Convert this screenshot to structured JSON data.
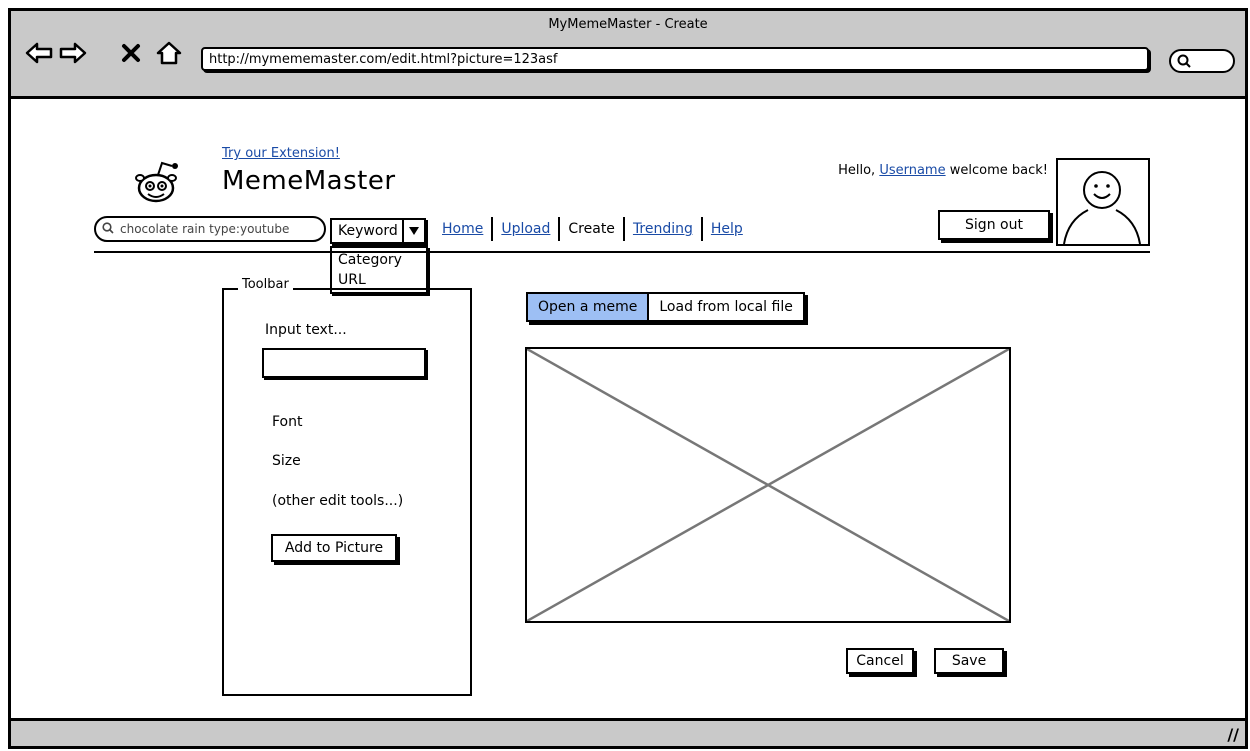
{
  "window": {
    "title": "MyMemeMaster - Create",
    "url": "http://mymememaster.com/edit.html?picture=123asf"
  },
  "header": {
    "extension_link": "Try our Extension!",
    "logo_text": "MemeMaster",
    "greeting_prefix": "Hello,",
    "username": "Username",
    "greeting_suffix": "welcome back!",
    "sign_out": "Sign out"
  },
  "search": {
    "query": "chocolate rain type:youtube",
    "type_selected": "Keyword",
    "type_options": [
      "Category",
      "URL"
    ]
  },
  "nav": [
    {
      "label": "Home",
      "link": true
    },
    {
      "label": "Upload",
      "link": true
    },
    {
      "label": "Create",
      "link": false
    },
    {
      "label": "Trending",
      "link": true
    },
    {
      "label": "Help",
      "link": true
    }
  ],
  "toolbar": {
    "legend": "Toolbar",
    "input_label": "Input text...",
    "font_label": "Font",
    "size_label": "Size",
    "other_label": "(other edit tools...)",
    "add_button": "Add to Picture"
  },
  "editor": {
    "tabs": [
      "Open a meme",
      "Load from local file"
    ],
    "cancel": "Cancel",
    "save": "Save"
  },
  "colors": {
    "chrome": "#c9c9c9",
    "link": "#1a4ba6",
    "active_tab": "#9dbff4"
  }
}
